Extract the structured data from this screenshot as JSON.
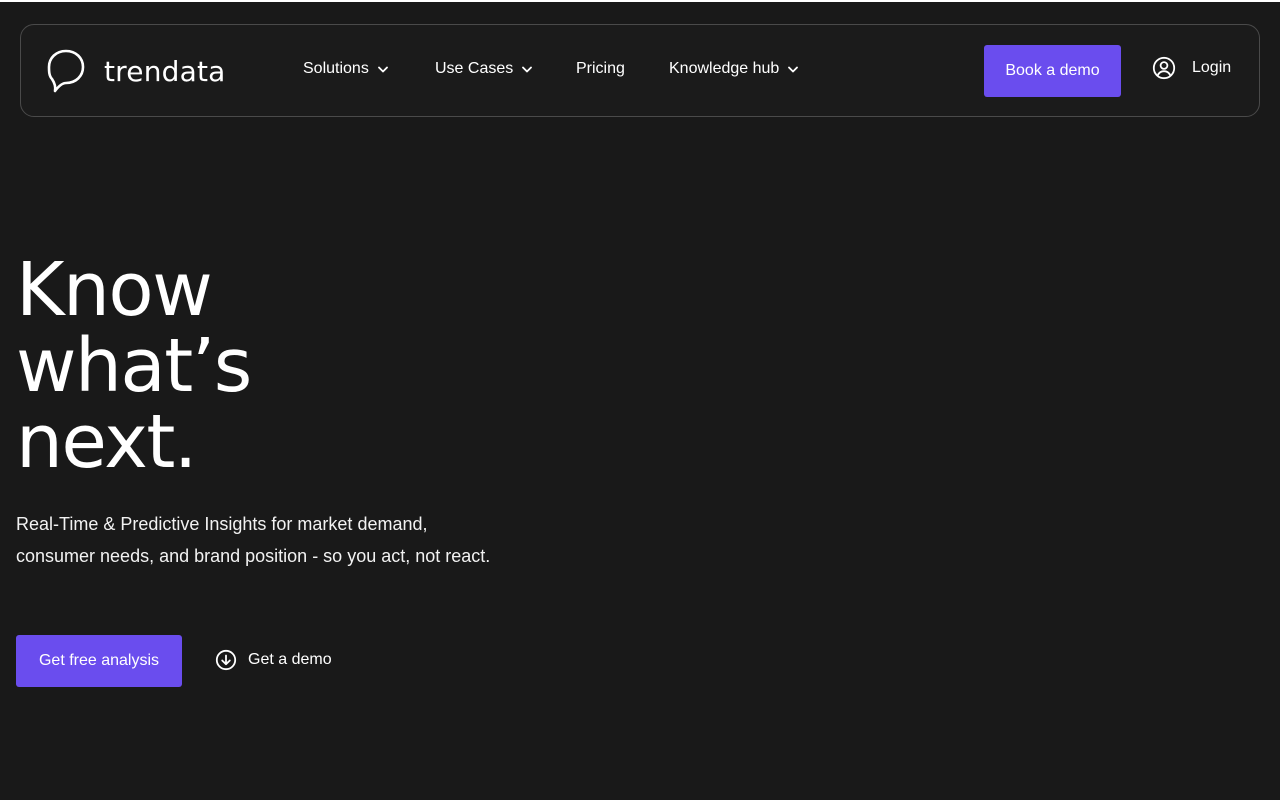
{
  "brand": {
    "name": "trendata",
    "logo_icon": "speech-bubble-icon"
  },
  "nav": {
    "items": [
      {
        "label": "Solutions",
        "has_dropdown": true
      },
      {
        "label": "Use Cases",
        "has_dropdown": true
      },
      {
        "label": "Pricing",
        "has_dropdown": false
      },
      {
        "label": "Knowledge hub",
        "has_dropdown": true
      }
    ],
    "book_demo_label": "Book a demo",
    "login_label": "Login",
    "login_icon": "user-circle-icon"
  },
  "hero": {
    "title_lines": [
      "Know",
      "what’s",
      "next."
    ],
    "subtitle": "Real-Time & Predictive Insights for market demand, consumer needs, and brand position - so you act, not react.",
    "primary_cta": "Get free analysis",
    "secondary_cta": "Get a demo",
    "secondary_icon": "arrow-down-circle-icon"
  },
  "colors": {
    "background": "#191919",
    "accent": "#6a4dee",
    "nav_border": "#4a4a4a",
    "text": "#ffffff"
  }
}
